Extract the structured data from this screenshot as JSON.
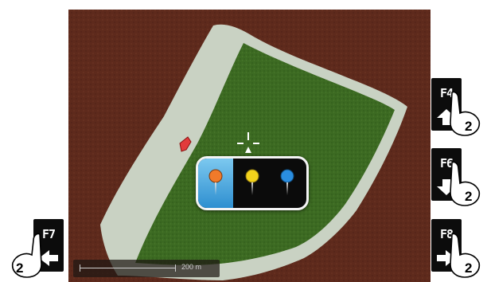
{
  "function_keys": {
    "f4": {
      "label": "F4",
      "arrow": "up-arrow-icon",
      "badge": "2"
    },
    "f6": {
      "label": "F6",
      "arrow": "down-arrow-icon",
      "badge": "2"
    },
    "f8": {
      "label": "F8",
      "arrow": "right-arrow-icon",
      "badge": "2"
    },
    "f7": {
      "label": "F7",
      "arrow": "left-arrow-icon",
      "badge": "2"
    }
  },
  "scale_bar": {
    "label": "200 m"
  },
  "marker_picker": {
    "selected": "orange",
    "options": [
      {
        "name": "orange",
        "color": "#f07a2a"
      },
      {
        "name": "yellow",
        "color": "#f2d21c"
      },
      {
        "name": "blue",
        "color": "#2a8ee0"
      }
    ]
  },
  "colors": {
    "soil": "#5e2a1c",
    "crop": "#3c6a22",
    "headland": "#c9d2c3",
    "picker_highlight": "#4aa8e4"
  }
}
